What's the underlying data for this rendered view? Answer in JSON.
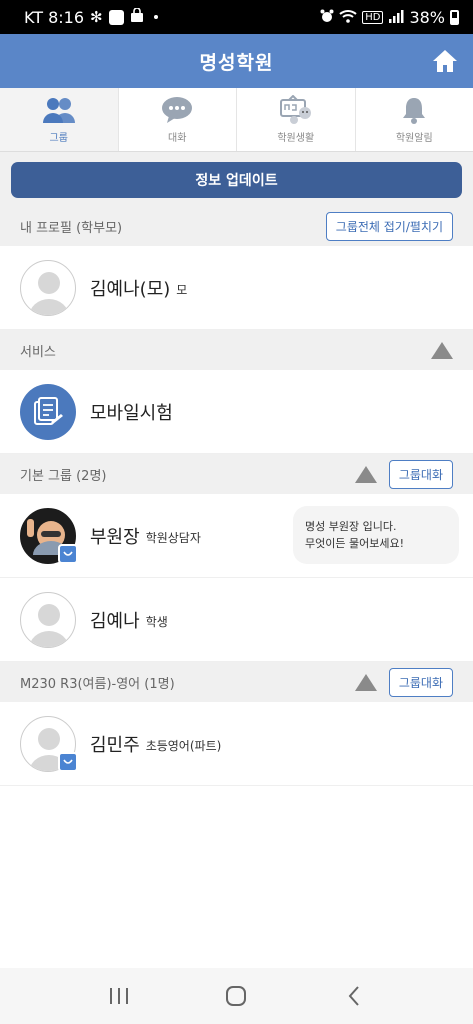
{
  "status_bar": {
    "carrier_time": "KT 8:16",
    "hd_label": "HD",
    "battery": "38%"
  },
  "header": {
    "title": "명성학원",
    "home_icon": "home-icon"
  },
  "tabs": [
    {
      "label": "그룹",
      "icon": "group-icon",
      "active": true
    },
    {
      "label": "대화",
      "icon": "chat-icon",
      "active": false
    },
    {
      "label": "학원생활",
      "icon": "classroom-icon",
      "active": false
    },
    {
      "label": "학원알림",
      "icon": "bell-icon",
      "active": false
    }
  ],
  "update_button": "정보 업데이트",
  "sections": {
    "profile": {
      "title": "내 프로필 (학부모)",
      "toggle_all_button": "그룹전체 접기/펼치기",
      "members": [
        {
          "name": "김예나(모)",
          "role": "모"
        }
      ]
    },
    "service": {
      "title": "서비스",
      "items": [
        {
          "name": "모바일시험",
          "icon": "document-icon"
        }
      ]
    },
    "basic_group": {
      "title": "기본 그룹 (2명)",
      "chat_button": "그룹대화",
      "members": [
        {
          "name": "부원장",
          "role": "학원상담자",
          "message_line1": "명성 부원장 입니다.",
          "message_line2": "무엇이든 물어보세요!"
        },
        {
          "name": "김예나",
          "role": "학생"
        }
      ]
    },
    "class_group": {
      "title": "M230 R3(여름)-영어 (1명)",
      "chat_button": "그룹대화",
      "members": [
        {
          "name": "김민주",
          "role": "초등영어(파트)"
        }
      ]
    }
  },
  "colors": {
    "header": "#5a86c8",
    "update_button": "#3d5f97",
    "accent": "#4b79bd"
  }
}
